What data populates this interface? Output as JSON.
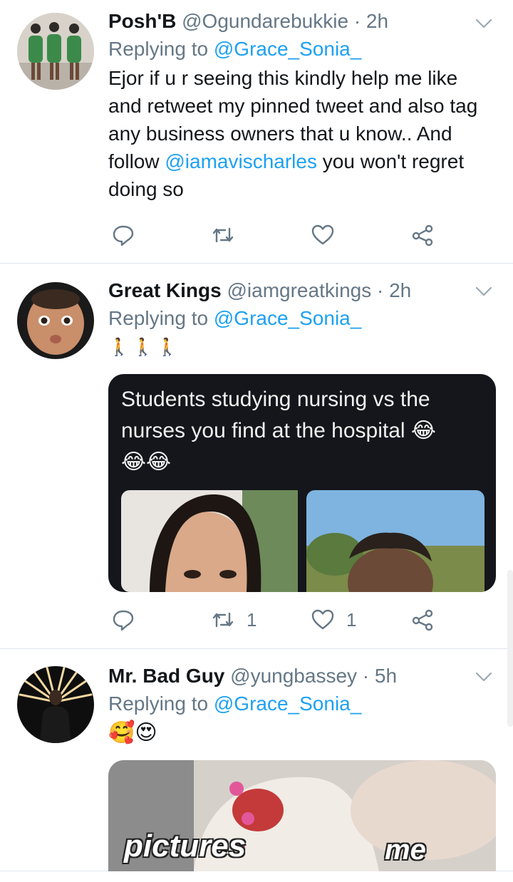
{
  "tweets": [
    {
      "name": "Posh'B",
      "handle": "@Ogundarebukkie",
      "dot": "·",
      "time": "2h",
      "reply_prefix": "Replying to",
      "reply_to": "@Grace_Sonia_",
      "text_1": "Ejor if u r seeing this kindly help me like and retweet my pinned tweet and also tag any business owners that u know.. And follow ",
      "mention": "@iamavischarles",
      "text_2": " you won't regret doing so",
      "retweets": "",
      "likes": ""
    },
    {
      "name": "Great Kings",
      "handle": "@iamgreatkings",
      "dot": "·",
      "time": "2h",
      "reply_prefix": "Replying to",
      "reply_to": "@Grace_Sonia_",
      "text": "🚶🚶🚶",
      "media_caption_line1": "Students studying nursing vs the",
      "media_caption_line2": "nurses you find at the hospital 😂",
      "media_caption_line3": "😂😂",
      "retweets": "1",
      "likes": "1"
    },
    {
      "name": "Mr. Bad Guy",
      "handle": "@yungbassey",
      "dot": "·",
      "time": "5h",
      "reply_prefix": "Replying to",
      "reply_to": "@Grace_Sonia_",
      "text": "🥰😍",
      "media_word_left": "pictures",
      "media_word_right": "me"
    }
  ],
  "colors": {
    "link": "#1da1f2",
    "secondary": "#657786",
    "divider": "#e1e8ed"
  },
  "icons": [
    "reply-icon",
    "retweet-icon",
    "like-icon",
    "share-icon",
    "chevron-down-icon"
  ]
}
